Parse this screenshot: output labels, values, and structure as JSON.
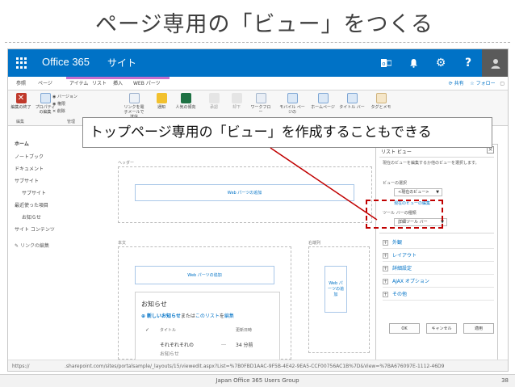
{
  "slide": {
    "title": "ページ専用の「ビュー」をつくる",
    "callout": "トップページ専用の「ビュー」を作成することもできる",
    "footer_text": "Japan Office 365 Users Group",
    "page_number": "38"
  },
  "suite_bar": {
    "brand": "Office 365",
    "site_label": "サイト",
    "bg_color": "#0072c6",
    "icons": [
      "app-launcher-icon",
      "outlook-icon",
      "bell-icon",
      "gear-icon",
      "help-icon",
      "avatar"
    ]
  },
  "ribbon": {
    "tabs": [
      "参照",
      "ページ",
      "アイテム",
      "リスト",
      "挿入",
      "WEB パーツ"
    ],
    "page_actions": [
      "共有",
      "フォロー"
    ],
    "buttons": {
      "edit_end": "編集の終了",
      "properties": "プロパティの編集",
      "version": "バージョン",
      "permissions": "権限",
      "delete": "削除",
      "manage": "管理",
      "link": "リンクを電子メールで送信",
      "alert": "通知",
      "popularity": "人気の傾向",
      "approve": "承認",
      "reject": "却下",
      "workflow": "ワークフロー",
      "mobile": "モバイル ページの",
      "homepage": "ホームページ",
      "title_bar": "タイトル バー",
      "tags": "タグとメモ"
    },
    "groups": {
      "edit": "編集",
      "manage": "管理"
    }
  },
  "leftnav": {
    "items": [
      "ホーム",
      "ノートブック",
      "ドキュメント",
      "サブサイト",
      "サブサイト",
      "最近使った項目",
      "お知らせ",
      "サイト コンテンツ"
    ],
    "edit_links": "リンクの編集"
  },
  "page": {
    "header_zone": "ヘッダー",
    "body_zone": "本文",
    "right_zone": "右端列",
    "add_webpart": "Web パーツの追加",
    "add_webpart_narrow": "Web パーツの追加"
  },
  "announcements": {
    "title": "お知らせ",
    "new_link": "新しいお知らせ",
    "new_middle": "または",
    "new_this": "このリスト",
    "new_end": "を",
    "new_edit": "編集",
    "columns": [
      "タイトル",
      "更新日時"
    ],
    "rows": [
      {
        "title": "それぞれそれの",
        "time": "34 分前"
      },
      {
        "title": "お知らせ",
        "time": ""
      }
    ],
    "ellipsis": "…"
  },
  "tool_pane": {
    "title": "リスト ビュー",
    "desc": "現在のビューを編集するか他のビューを選択します。",
    "view_label": "ビューの選択",
    "view_value": "<現在のビュー>",
    "edit_view_link": "現在のビューの編集",
    "toolbar_label": "ツール バーの種類",
    "toolbar_value": "詳細ツール バー",
    "sections": [
      "外観",
      "レイアウト",
      "詳細設定",
      "AJAX オプション",
      "その他"
    ],
    "buttons": [
      "OK",
      "キャンセル",
      "適用"
    ]
  },
  "status_bar": {
    "left": "https://",
    "url": ".sharepoint.com/sites/portalsample/_layouts/15/viewedit.aspx?List=%7B0FBD1AAC-9F5B-4E42-9EA5-CCF00756AC1B%7D&View=%7BA676097E-1112-46D9"
  },
  "colors": {
    "accent": "#0072c6",
    "highlight": "#c00000",
    "tab_highlight": "#c86fcd"
  }
}
